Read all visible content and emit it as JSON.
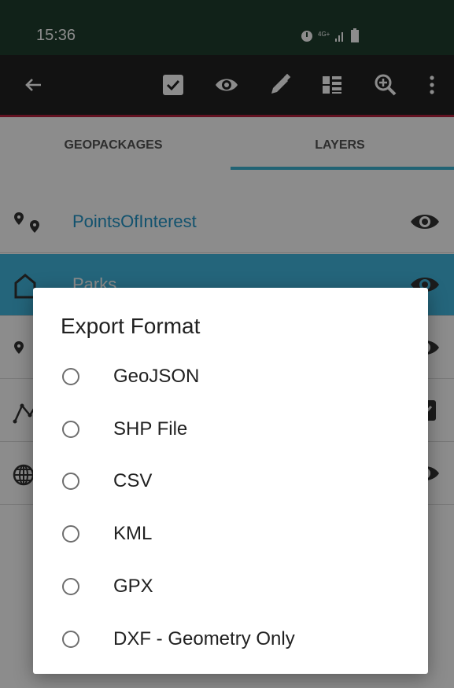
{
  "status_bar": {
    "time": "15:36",
    "network": "4G+",
    "icons": [
      "alarm-icon",
      "network-icon",
      "signal-icon",
      "battery-icon"
    ]
  },
  "toolbar": {
    "icons": [
      "back-arrow-icon",
      "checkbox-icon",
      "eye-icon",
      "pencil-icon",
      "list-icon",
      "zoom-in-icon",
      "more-vert-icon"
    ]
  },
  "tabs": [
    {
      "label": "GEOPACKAGES",
      "selected": false
    },
    {
      "label": "LAYERS",
      "selected": true
    }
  ],
  "layers": [
    {
      "name": "PointsOfInterest",
      "icon": "points-icon",
      "selected": false
    },
    {
      "name": "Parks",
      "icon": "polygon-icon",
      "selected": true
    },
    {
      "name": "",
      "icon": "point-icon",
      "selected": false
    },
    {
      "name": "",
      "icon": "line-icon",
      "selected": false
    },
    {
      "name": "",
      "icon": "globe-icon",
      "selected": false
    }
  ],
  "dialog": {
    "title": "Export Format",
    "options": [
      "GeoJSON",
      "SHP File",
      "CSV",
      "KML",
      "GPX",
      "DXF - Geometry Only"
    ],
    "selected": null
  },
  "colors": {
    "status_bar": "#1f3f2e",
    "toolbar": "#222222",
    "accent_line": "#b4213c",
    "tab_indicator": "#3cb4d4",
    "selected_row": "#43b9e0",
    "layer_text": "#2196c8"
  }
}
